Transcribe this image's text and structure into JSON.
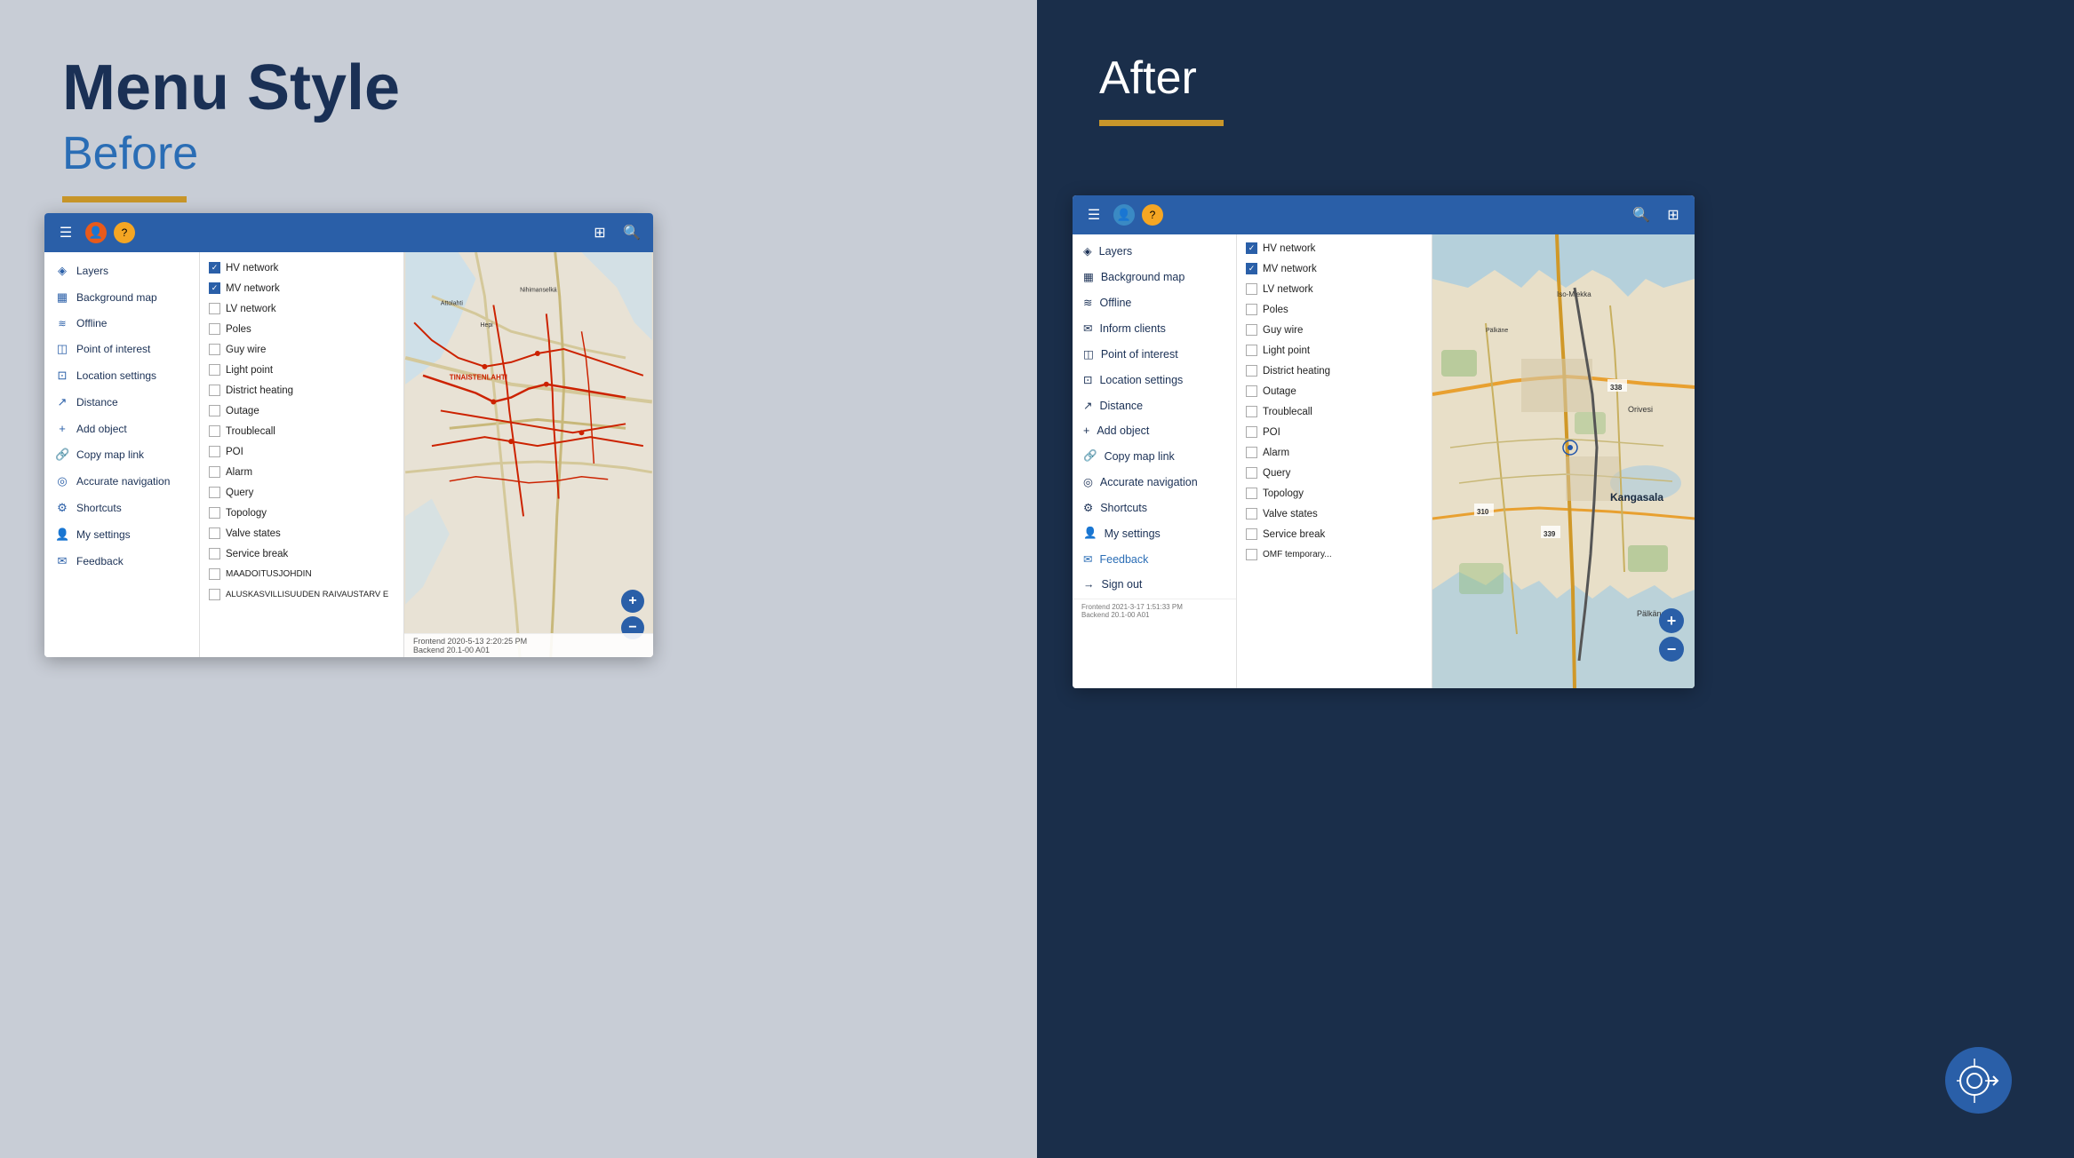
{
  "left": {
    "title": "Menu Style",
    "subtitle": "Before",
    "browser": {
      "toolbar_icons": [
        "☰",
        "👤",
        "?"
      ],
      "toolbar_right": [
        "⊞",
        "🔍"
      ],
      "sidebar_items": [
        {
          "icon": "◈",
          "label": "Layers"
        },
        {
          "icon": "▦",
          "label": "Background map"
        },
        {
          "icon": "≋",
          "label": "Offline"
        },
        {
          "icon": "◫",
          "label": "Point of interest"
        },
        {
          "icon": "⊡",
          "label": "Location settings"
        },
        {
          "icon": "↗",
          "label": "Distance"
        },
        {
          "icon": "+",
          "label": "Add object"
        },
        {
          "icon": "🔗",
          "label": "Copy map link"
        },
        {
          "icon": "◎",
          "label": "Accurate navigation"
        },
        {
          "icon": "⚙",
          "label": "Shortcuts"
        },
        {
          "icon": "👤",
          "label": "My settings"
        },
        {
          "icon": "✉",
          "label": "Feedback"
        }
      ],
      "layers": [
        {
          "checked": true,
          "label": "HV network"
        },
        {
          "checked": true,
          "label": "MV network"
        },
        {
          "checked": false,
          "label": "LV network"
        },
        {
          "checked": false,
          "label": "Poles"
        },
        {
          "checked": false,
          "label": "Guy wire"
        },
        {
          "checked": false,
          "label": "Light point"
        },
        {
          "checked": false,
          "label": "District heating"
        },
        {
          "checked": false,
          "label": "Outage"
        },
        {
          "checked": false,
          "label": "Troublecall"
        },
        {
          "checked": false,
          "label": "POI"
        },
        {
          "checked": false,
          "label": "Alarm"
        },
        {
          "checked": false,
          "label": "Query"
        },
        {
          "checked": false,
          "label": "Topology"
        },
        {
          "checked": false,
          "label": "Valve states"
        },
        {
          "checked": false,
          "label": "Service break"
        },
        {
          "checked": false,
          "label": "MAADOITUSJOHDIN"
        },
        {
          "checked": false,
          "label": "ALUSKASVILLISUUDEN RAIVAUSTARVE"
        }
      ],
      "footer": "Frontend 2020-5-13 2:20:25 PM\nBackend 20.1-00 A01"
    }
  },
  "right": {
    "title": "After",
    "browser": {
      "toolbar_icons": [
        "☰",
        "👤",
        "?"
      ],
      "toolbar_right": [
        "🔍",
        "⊞"
      ],
      "sidebar_items": [
        {
          "icon": "◈",
          "label": "Layers"
        },
        {
          "icon": "▦",
          "label": "Background map"
        },
        {
          "icon": "≋",
          "label": "Offline"
        },
        {
          "icon": "✉",
          "label": "Inform clients"
        },
        {
          "icon": "◫",
          "label": "Point of interest"
        },
        {
          "icon": "⊡",
          "label": "Location settings"
        },
        {
          "icon": "↗",
          "label": "Distance"
        },
        {
          "icon": "+",
          "label": "Add object"
        },
        {
          "icon": "🔗",
          "label": "Copy map link"
        },
        {
          "icon": "◎",
          "label": "Accurate navigation"
        },
        {
          "icon": "⚙",
          "label": "Shortcuts"
        },
        {
          "icon": "👤",
          "label": "My settings"
        },
        {
          "icon": "✉",
          "label": "Feedback",
          "highlight": true
        },
        {
          "icon": "→",
          "label": "Sign out"
        }
      ],
      "layers": [
        {
          "checked": true,
          "label": "HV network"
        },
        {
          "checked": true,
          "label": "MV network"
        },
        {
          "checked": false,
          "label": "LV network"
        },
        {
          "checked": false,
          "label": "Poles"
        },
        {
          "checked": false,
          "label": "Guy wire"
        },
        {
          "checked": false,
          "label": "Light point"
        },
        {
          "checked": false,
          "label": "District heating"
        },
        {
          "checked": false,
          "label": "Outage"
        },
        {
          "checked": false,
          "label": "Troublecall"
        },
        {
          "checked": false,
          "label": "POI"
        },
        {
          "checked": false,
          "label": "Alarm"
        },
        {
          "checked": false,
          "label": "Query"
        },
        {
          "checked": false,
          "label": "Topology"
        },
        {
          "checked": false,
          "label": "Valve states"
        },
        {
          "checked": false,
          "label": "Service break"
        },
        {
          "checked": false,
          "label": "OMF temporary..."
        }
      ],
      "footer": "Frontend 2021-3-17 1:51:33 PM\nBackend 20.1-00 A01"
    }
  }
}
